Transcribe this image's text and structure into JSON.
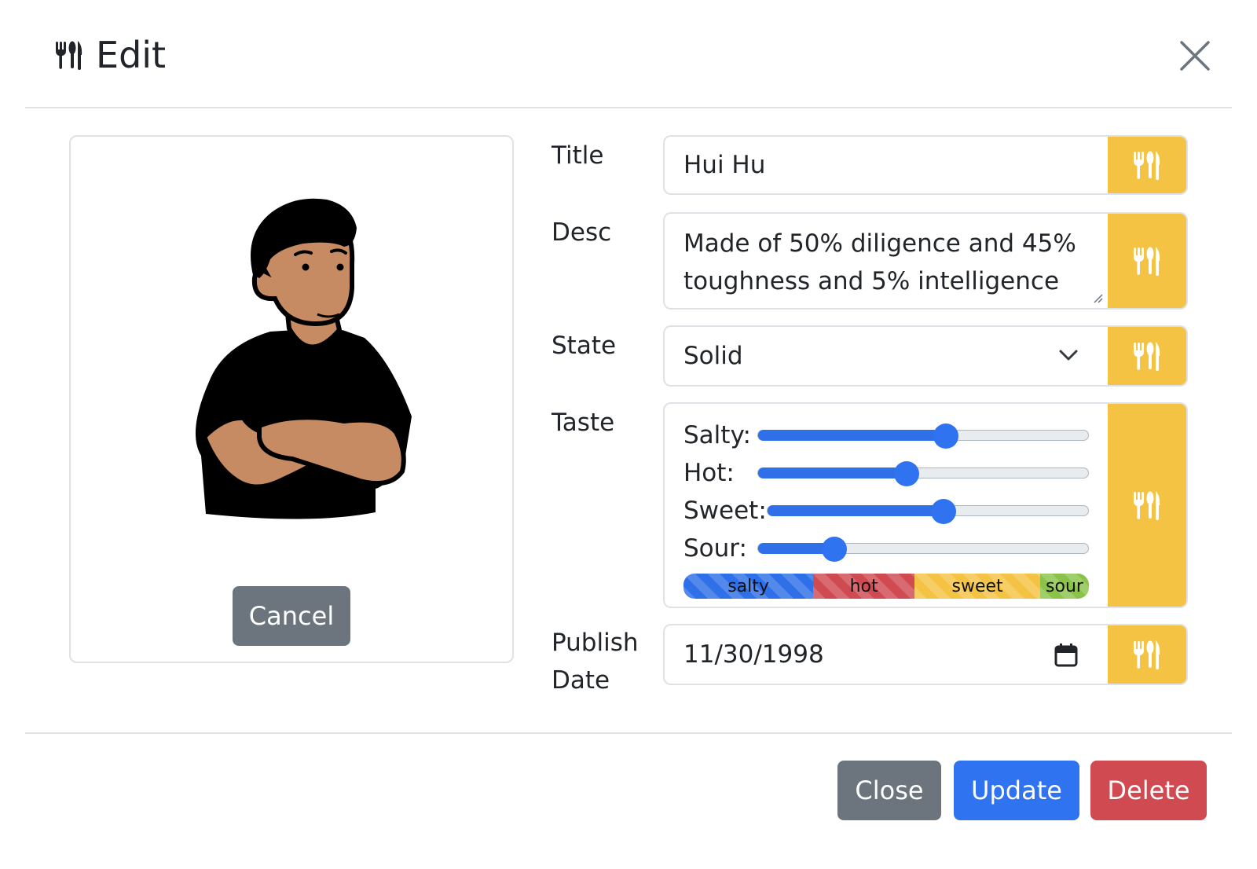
{
  "header": {
    "title": "Edit",
    "title_icon": "utensils-icon",
    "close_icon": "close-icon"
  },
  "image_panel": {
    "cancel_label": "Cancel",
    "image": "person-arms-crossed-illustration"
  },
  "form": {
    "title": {
      "label": "Title",
      "value": "Hui Hu"
    },
    "desc": {
      "label": "Desc",
      "value": "Made of 50% diligence and 45% toughness and 5% intelligence"
    },
    "state": {
      "label": "State",
      "value": "Solid"
    },
    "taste": {
      "label": "Taste",
      "sliders": [
        {
          "label": "Salty:",
          "value": 0.57
        },
        {
          "label": "Hot:",
          "value": 0.45
        },
        {
          "label": "Sweet:",
          "value": 0.55
        },
        {
          "label": "Sour:",
          "value": 0.23
        }
      ],
      "bar": [
        {
          "label": "salty",
          "share": 0.32,
          "color": "#2f6fe8"
        },
        {
          "label": "hot",
          "share": 0.25,
          "color": "#d04a52"
        },
        {
          "label": "sweet",
          "share": 0.31,
          "color": "#f5c344"
        },
        {
          "label": "sour",
          "share": 0.12,
          "color": "#8bc34a"
        }
      ]
    },
    "publish_date": {
      "label_line1": "Publish",
      "label_line2": "Date",
      "value": "11/30/1998"
    },
    "addon_icon": "utensils-icon"
  },
  "footer": {
    "close_label": "Close",
    "update_label": "Update",
    "delete_label": "Delete"
  },
  "colors": {
    "accent": "#f5c344",
    "primary": "#2f6fe8",
    "secondary": "#6c757d",
    "danger": "#d04a52"
  }
}
